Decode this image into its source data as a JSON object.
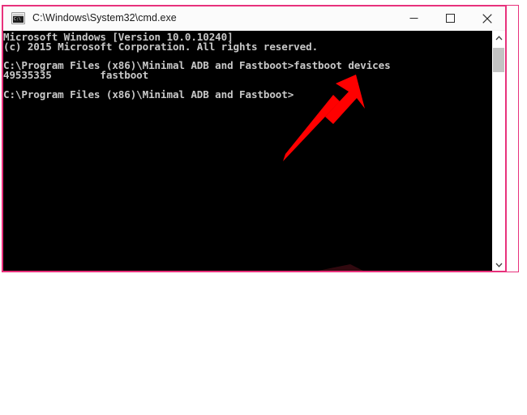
{
  "window": {
    "title": "C:\\Windows\\System32\\cmd.exe",
    "icon": "cmd-console-icon",
    "icon_glyph": "C:\\",
    "controls": [
      {
        "name": "minimize",
        "label": "Minimize",
        "glyph": "minimize-icon"
      },
      {
        "name": "maximize",
        "label": "Maximize",
        "glyph": "maximize-icon"
      },
      {
        "name": "close",
        "label": "Close",
        "glyph": "close-icon"
      }
    ]
  },
  "console": {
    "background_color": "#000000",
    "text_color": "#c8c8c8",
    "lines": [
      "Microsoft Windows [Version 10.0.10240]",
      "(c) 2015 Microsoft Corporation. All rights reserved.",
      "",
      "C:\\Program Files (x86)\\Minimal ADB and Fastboot>fastboot devices",
      "49535335        fastboot",
      "",
      "C:\\Program Files (x86)\\Minimal ADB and Fastboot>"
    ],
    "full_text": "Microsoft Windows [Version 10.0.10240]\n(c) 2015 Microsoft Corporation. All rights reserved.\n\nC:\\Program Files (x86)\\Minimal ADB and Fastboot>fastboot devices\n49535335        fastboot\n\nC:\\Program Files (x86)\\Minimal ADB and Fastboot>",
    "command": "fastboot devices",
    "device_serial": "49535335",
    "device_mode": "fastboot",
    "prompt": "C:\\Program Files (x86)\\Minimal ADB and Fastboot>"
  },
  "scrollbar": {
    "up_arrow": "chevron-up-icon",
    "down_arrow": "chevron-down-icon",
    "thumb_position_percent": 7
  },
  "annotations": {
    "arrow_color": "#ff0000",
    "arrow_target": "fastboot devices",
    "frame_color": "#e8327c"
  }
}
